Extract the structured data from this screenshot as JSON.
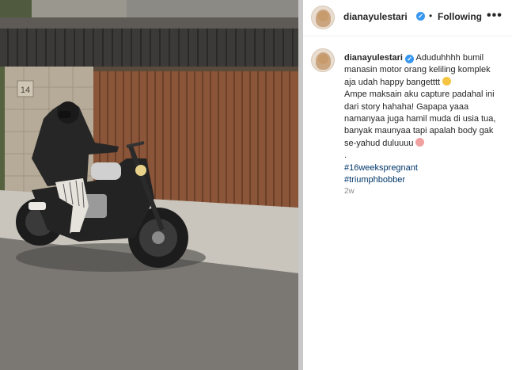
{
  "header": {
    "username": "dianayulestari",
    "verified_badge": "✓",
    "separator": "•",
    "follow_status": "Following",
    "more_icon": "•••"
  },
  "post": {
    "caption_username": "dianayulestari",
    "caption_lines": [
      "Aduduhhhh bumil",
      "manasin motor orang keliling komplek",
      "aja udah happy bangetttt",
      "Ampe maksain aku capture padahal ini",
      "dari story hahaha! Gapapa yaaa",
      "namanyaa juga hamil muda di usia tua,",
      "banyak maunyaa tapi apalah body gak",
      "se-yahud duluuuu",
      "."
    ],
    "hashtags": [
      "#16weekspregnant",
      "#triumphbobber"
    ],
    "time_ago": "2w"
  },
  "media": {
    "house_number": "14"
  },
  "colors": {
    "link": "#00376b",
    "verified": "#3897f0",
    "muted": "#8e8e8e",
    "text": "#262626"
  }
}
